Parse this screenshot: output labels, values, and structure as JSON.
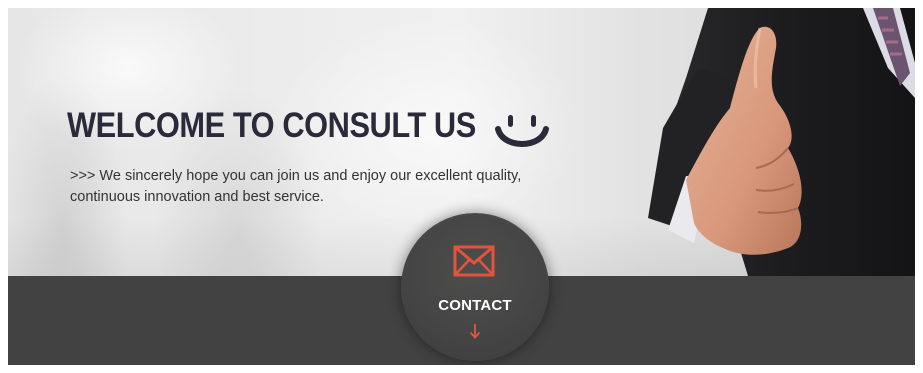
{
  "hero": {
    "headline": "WELCOME TO CONSULT US",
    "subtitle_line1": ">>> We sincerely hope you can join us and enjoy our excellent quality,",
    "subtitle_line2": "continuous innovation and best service."
  },
  "contact": {
    "label": "CONTACT",
    "icon": "envelope-icon",
    "arrow_icon": "arrow-down-icon"
  },
  "decor": {
    "smiley": "smiley-icon",
    "person": "businessman-handshake-image"
  },
  "colors": {
    "accent": "#e2553a",
    "headline": "#2a2a3a",
    "dark_band": "#424242"
  }
}
